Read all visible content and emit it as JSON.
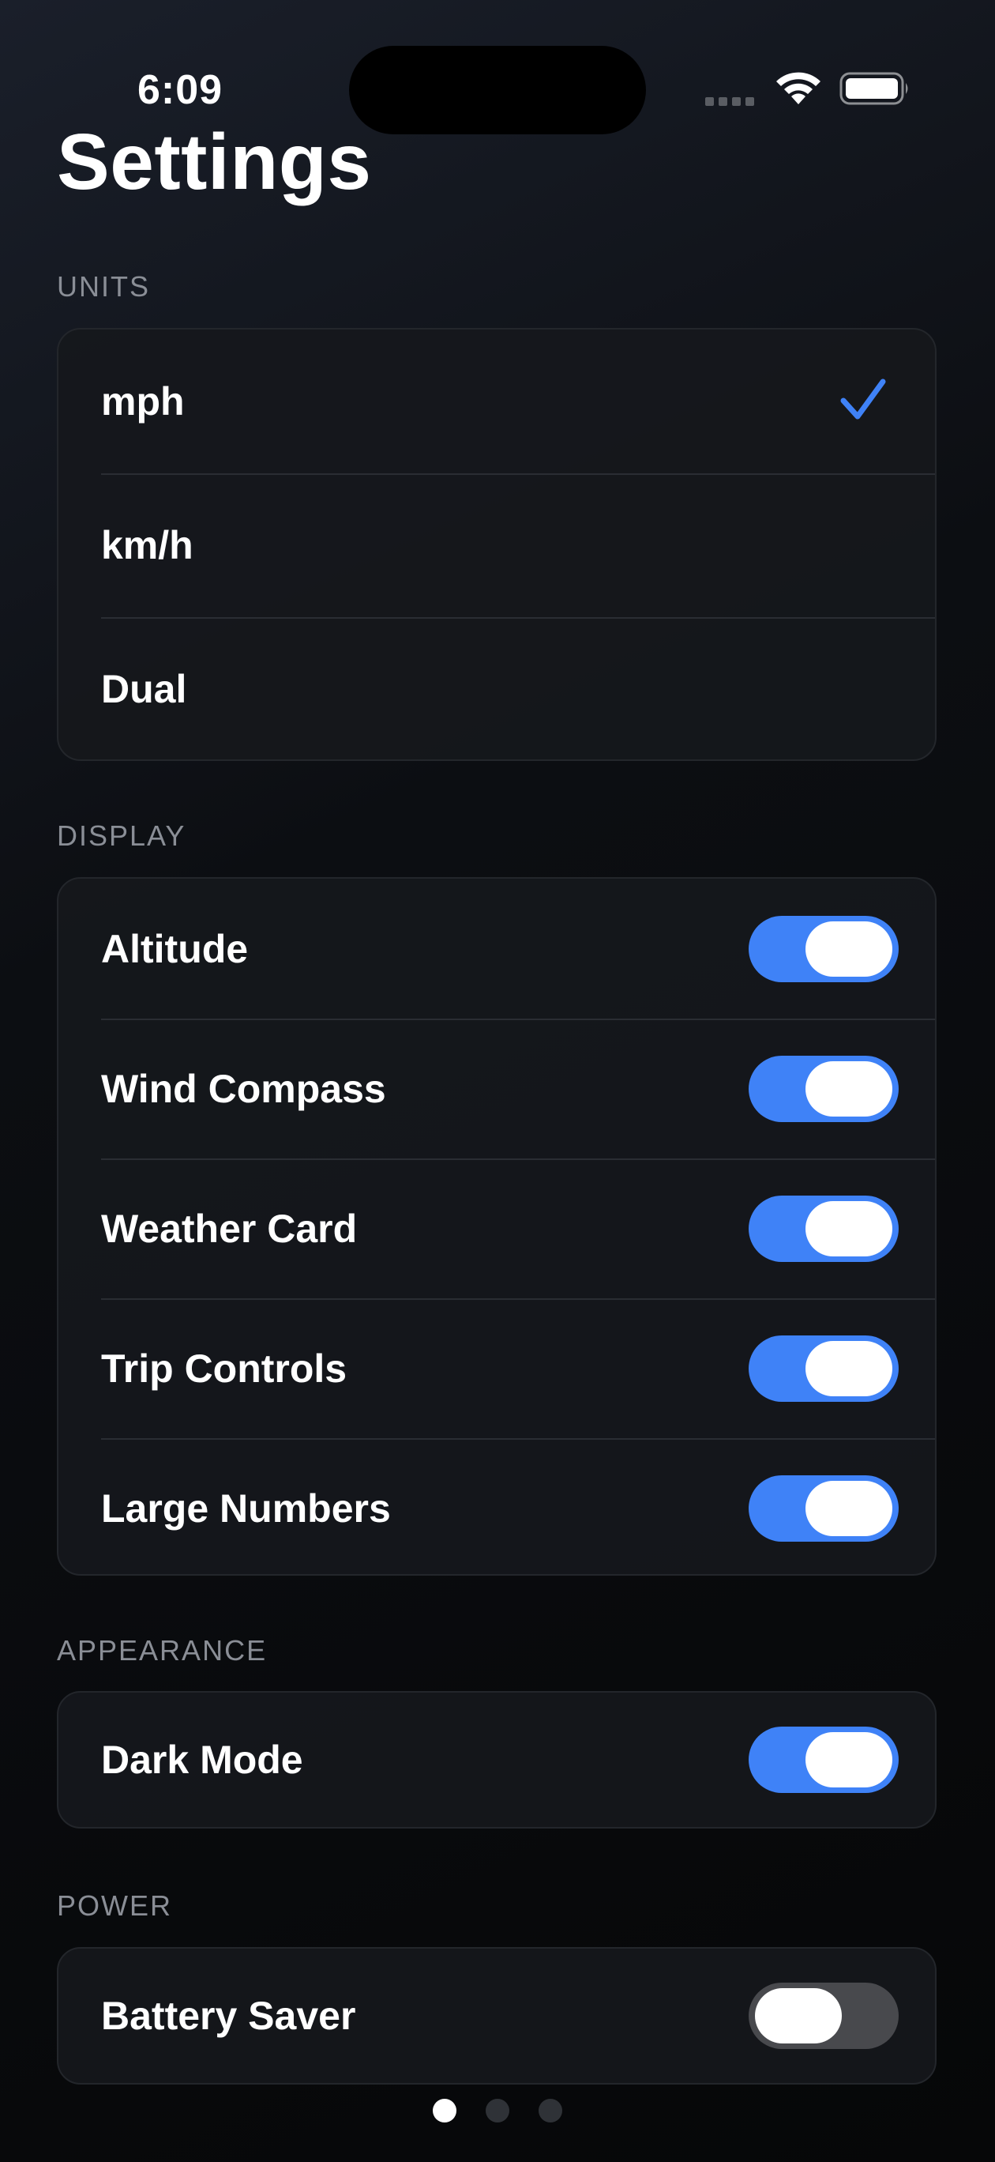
{
  "status_bar": {
    "time": "6:09",
    "icons": [
      "signal-dots-icon",
      "wifi-icon",
      "battery-icon"
    ]
  },
  "page": {
    "title": "Settings"
  },
  "sections": {
    "units": {
      "label": "UNITS",
      "options": [
        {
          "label": "mph",
          "selected": true
        },
        {
          "label": "km/h",
          "selected": false
        },
        {
          "label": "Dual",
          "selected": false
        }
      ]
    },
    "display": {
      "label": "DISPLAY",
      "items": [
        {
          "label": "Altitude",
          "on": true
        },
        {
          "label": "Wind Compass",
          "on": true
        },
        {
          "label": "Weather Card",
          "on": true
        },
        {
          "label": "Trip Controls",
          "on": true
        },
        {
          "label": "Large Numbers",
          "on": true
        }
      ]
    },
    "appearance": {
      "label": "APPEARANCE",
      "items": [
        {
          "label": "Dark Mode",
          "on": true
        }
      ]
    },
    "power": {
      "label": "POWER",
      "items": [
        {
          "label": "Battery Saver",
          "on": false
        }
      ]
    }
  },
  "pager": {
    "pages": 3,
    "current": 1
  },
  "colors": {
    "accent": "#3f82f7",
    "toggle_off": "#48494d",
    "section_label": "#8a8e96",
    "card_bg": "#16181c"
  }
}
